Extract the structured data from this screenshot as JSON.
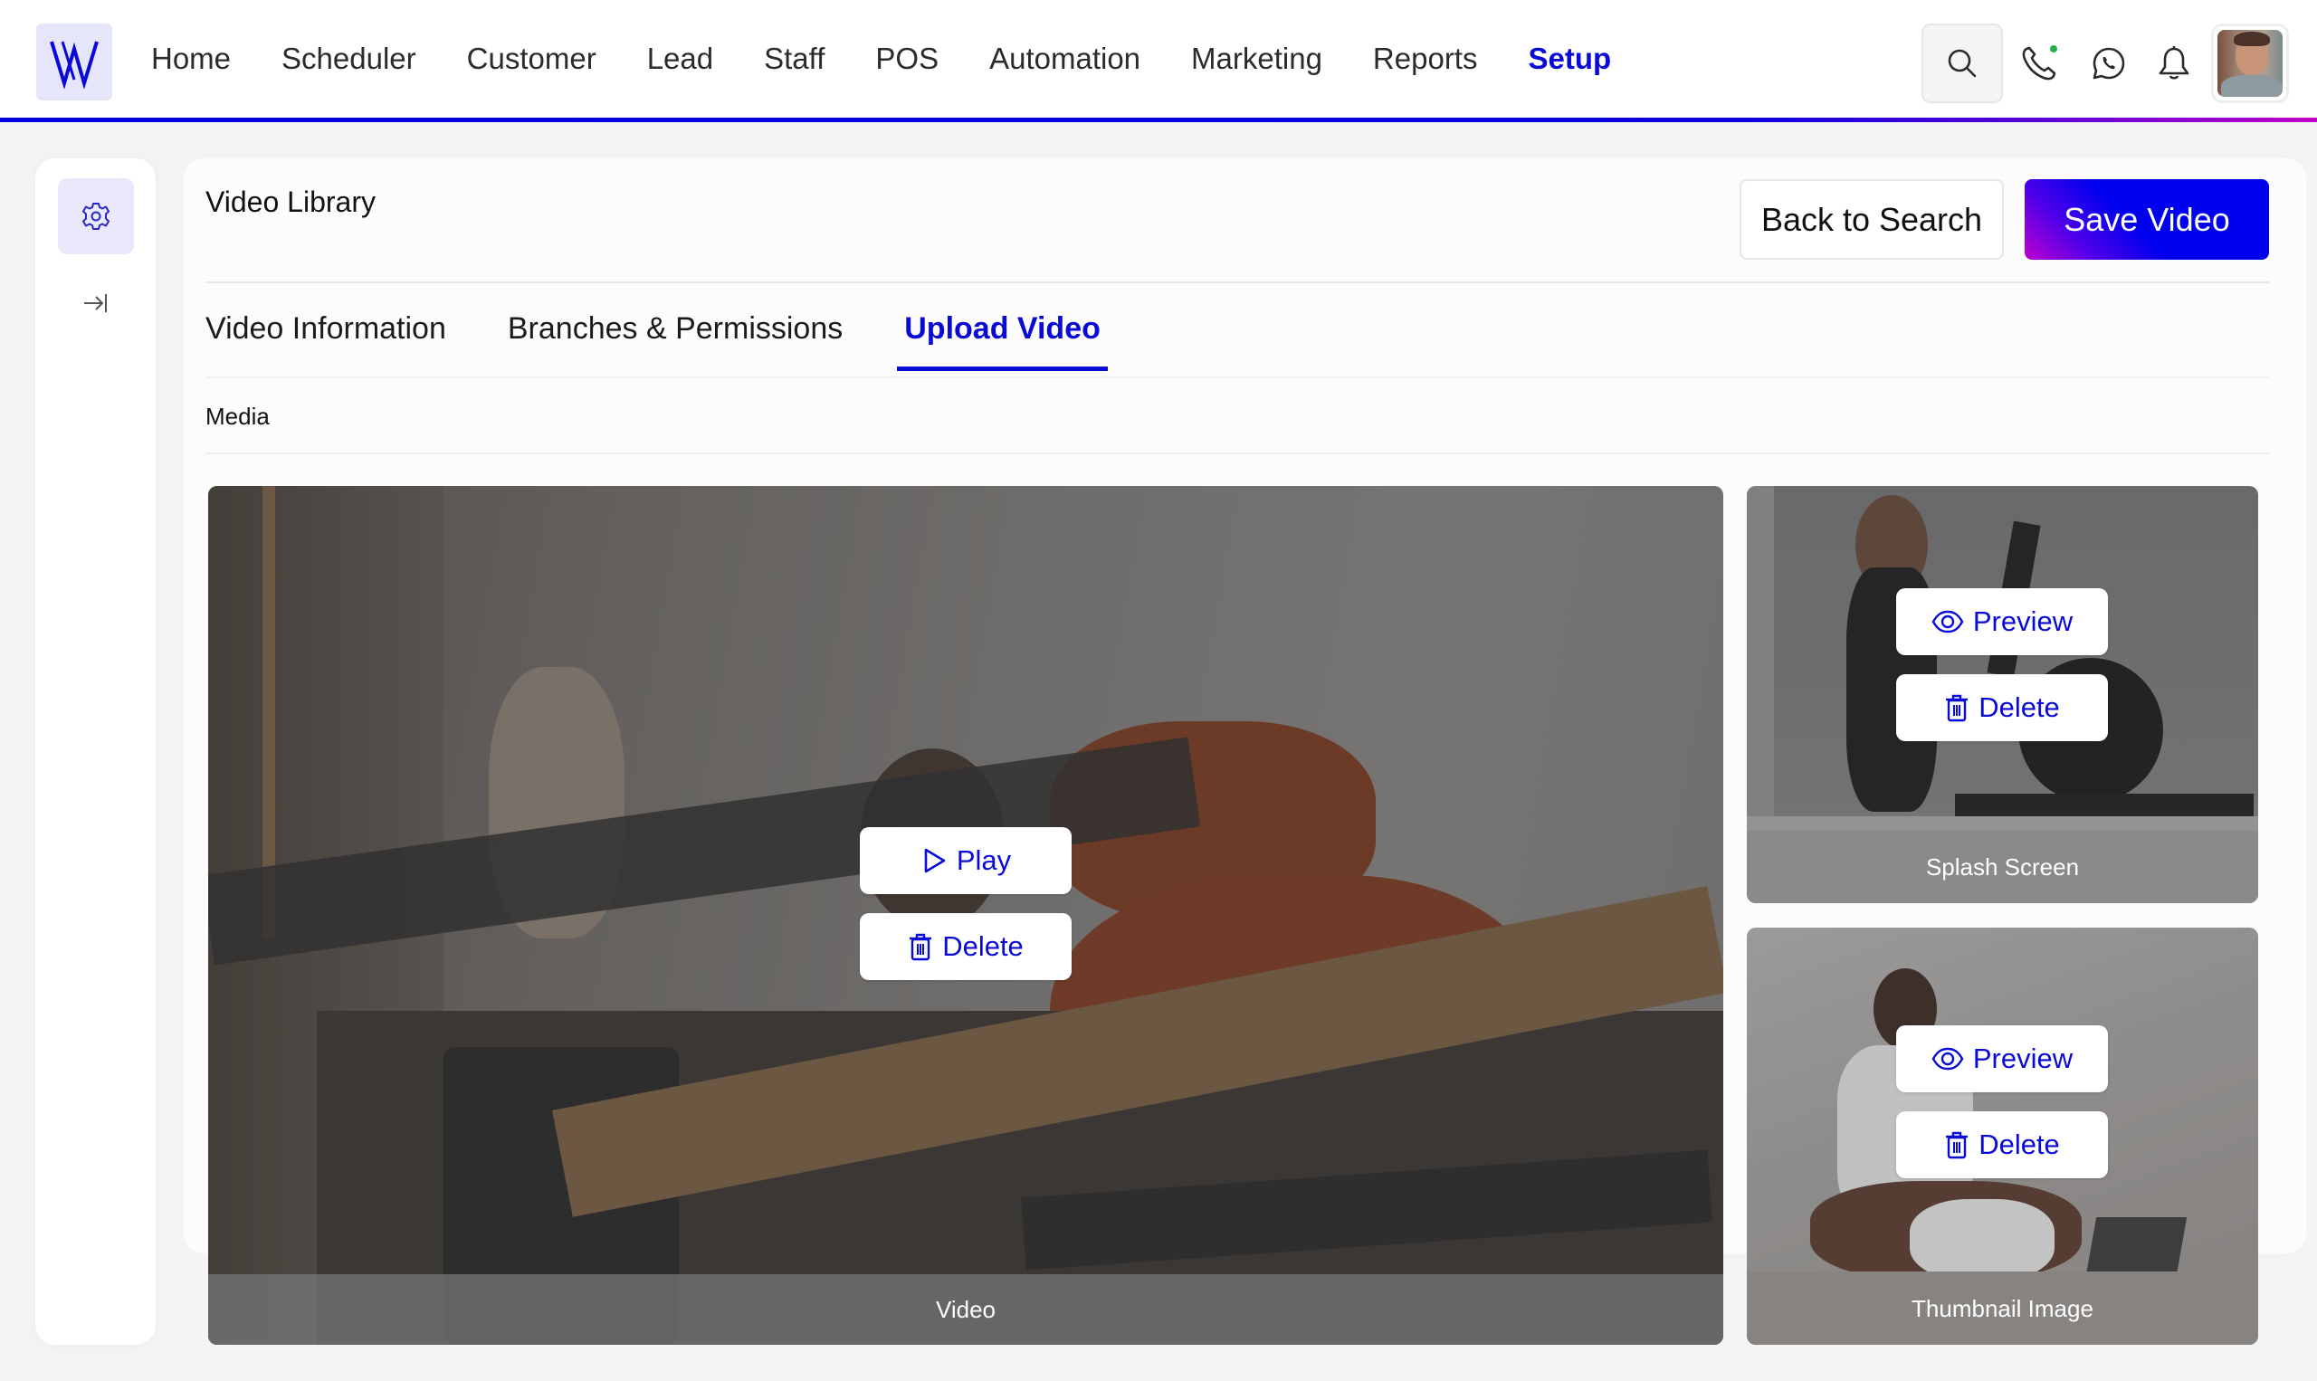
{
  "header": {
    "logo_letter": "W",
    "nav": [
      "Home",
      "Scheduler",
      "Customer",
      "Lead",
      "Staff",
      "POS",
      "Automation",
      "Marketing",
      "Reports",
      "Setup"
    ],
    "active_nav": "Setup",
    "icons": [
      "search-icon",
      "phone-icon",
      "whatsapp-icon",
      "bell-icon"
    ],
    "phone_status_color": "#22b14c",
    "accent_color": "#0a0ad6"
  },
  "sidebar": {
    "items": [
      {
        "icon": "gear-icon",
        "active": true
      },
      {
        "icon": "expand-sidebar-icon",
        "active": false
      }
    ]
  },
  "page": {
    "title": "Video Library",
    "back_label": "Back to Search",
    "save_label": "Save Video",
    "tabs": [
      {
        "label": "Video Information",
        "active": false
      },
      {
        "label": "Branches & Permissions",
        "active": false
      },
      {
        "label": "Upload Video",
        "active": true
      }
    ],
    "section_label": "Media"
  },
  "media": {
    "video": {
      "caption": "Video",
      "play_label": "Play",
      "delete_label": "Delete"
    },
    "splash": {
      "caption": "Splash Screen",
      "preview_label": "Preview",
      "delete_label": "Delete"
    },
    "thumbnail": {
      "caption": "Thumbnail Image",
      "preview_label": "Preview",
      "delete_label": "Delete"
    }
  }
}
